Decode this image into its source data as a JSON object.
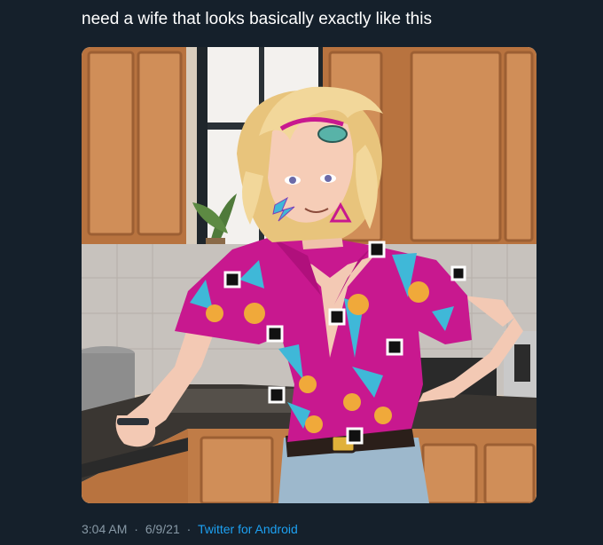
{
  "tweet": {
    "text": "need a wife that looks basically exactly like this",
    "media": {
      "kind": "illustration-over-kitchen-photo"
    },
    "meta": {
      "time": "3:04 AM",
      "date": "6/9/21",
      "separator": "·",
      "source": "Twitter for Android"
    }
  },
  "colors": {
    "background": "#15202b",
    "text": "#ffffff",
    "secondary_text": "#8899a6",
    "link": "#1da1f2",
    "cabinet": "#c98a55",
    "shirt": "#c8188f",
    "hair": "#f2d79a"
  }
}
